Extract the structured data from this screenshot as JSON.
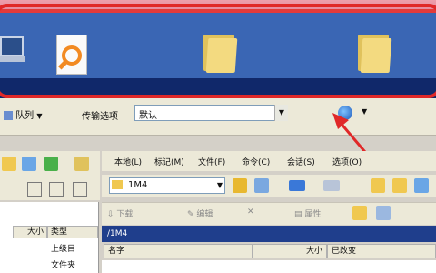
{
  "toolbar": {
    "queue_label": "队列",
    "transfer_mode_label": "传输选项",
    "transfer_mode_value": "默认"
  },
  "menu": [
    {
      "label": "本地(L)"
    },
    {
      "label": "标记(M)"
    },
    {
      "label": "文件(F)"
    },
    {
      "label": "命令(C)"
    },
    {
      "label": "会话(S)"
    },
    {
      "label": "选项(O)"
    }
  ],
  "local_pane": {
    "columns": [
      "大小",
      "类型"
    ],
    "rows": [
      "上级目",
      "文件夹"
    ]
  },
  "remote_pane": {
    "folder_value": "1M4",
    "actions": [
      "下载",
      "编辑",
      "属性"
    ],
    "current_path": "/1M4",
    "columns": [
      "名字",
      "大小",
      "已改变"
    ]
  },
  "colors": {
    "annotation_red": "#e02828",
    "desktop_blue": "#3a66b4",
    "path_bar_blue": "#1f3e8c"
  }
}
